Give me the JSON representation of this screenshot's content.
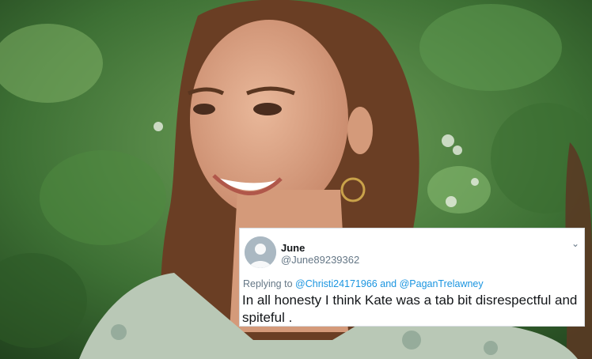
{
  "tweet": {
    "name": "June",
    "handle": "@June89239362",
    "reply_prefix": "Replying to",
    "reply_user_1": "@Christi24171966",
    "reply_and": "and",
    "reply_user_2": "@PaganTrelawney",
    "text": "In all honesty I think Kate was a tab bit disrespectful and spiteful .",
    "menu_icon": "chevron-down-icon",
    "avatar_icon": "default-avatar-icon"
  },
  "colors": {
    "link": "#1b95e0",
    "secondary_text": "#657786",
    "primary_text": "#14171a",
    "foliage": "#3f7a35"
  }
}
